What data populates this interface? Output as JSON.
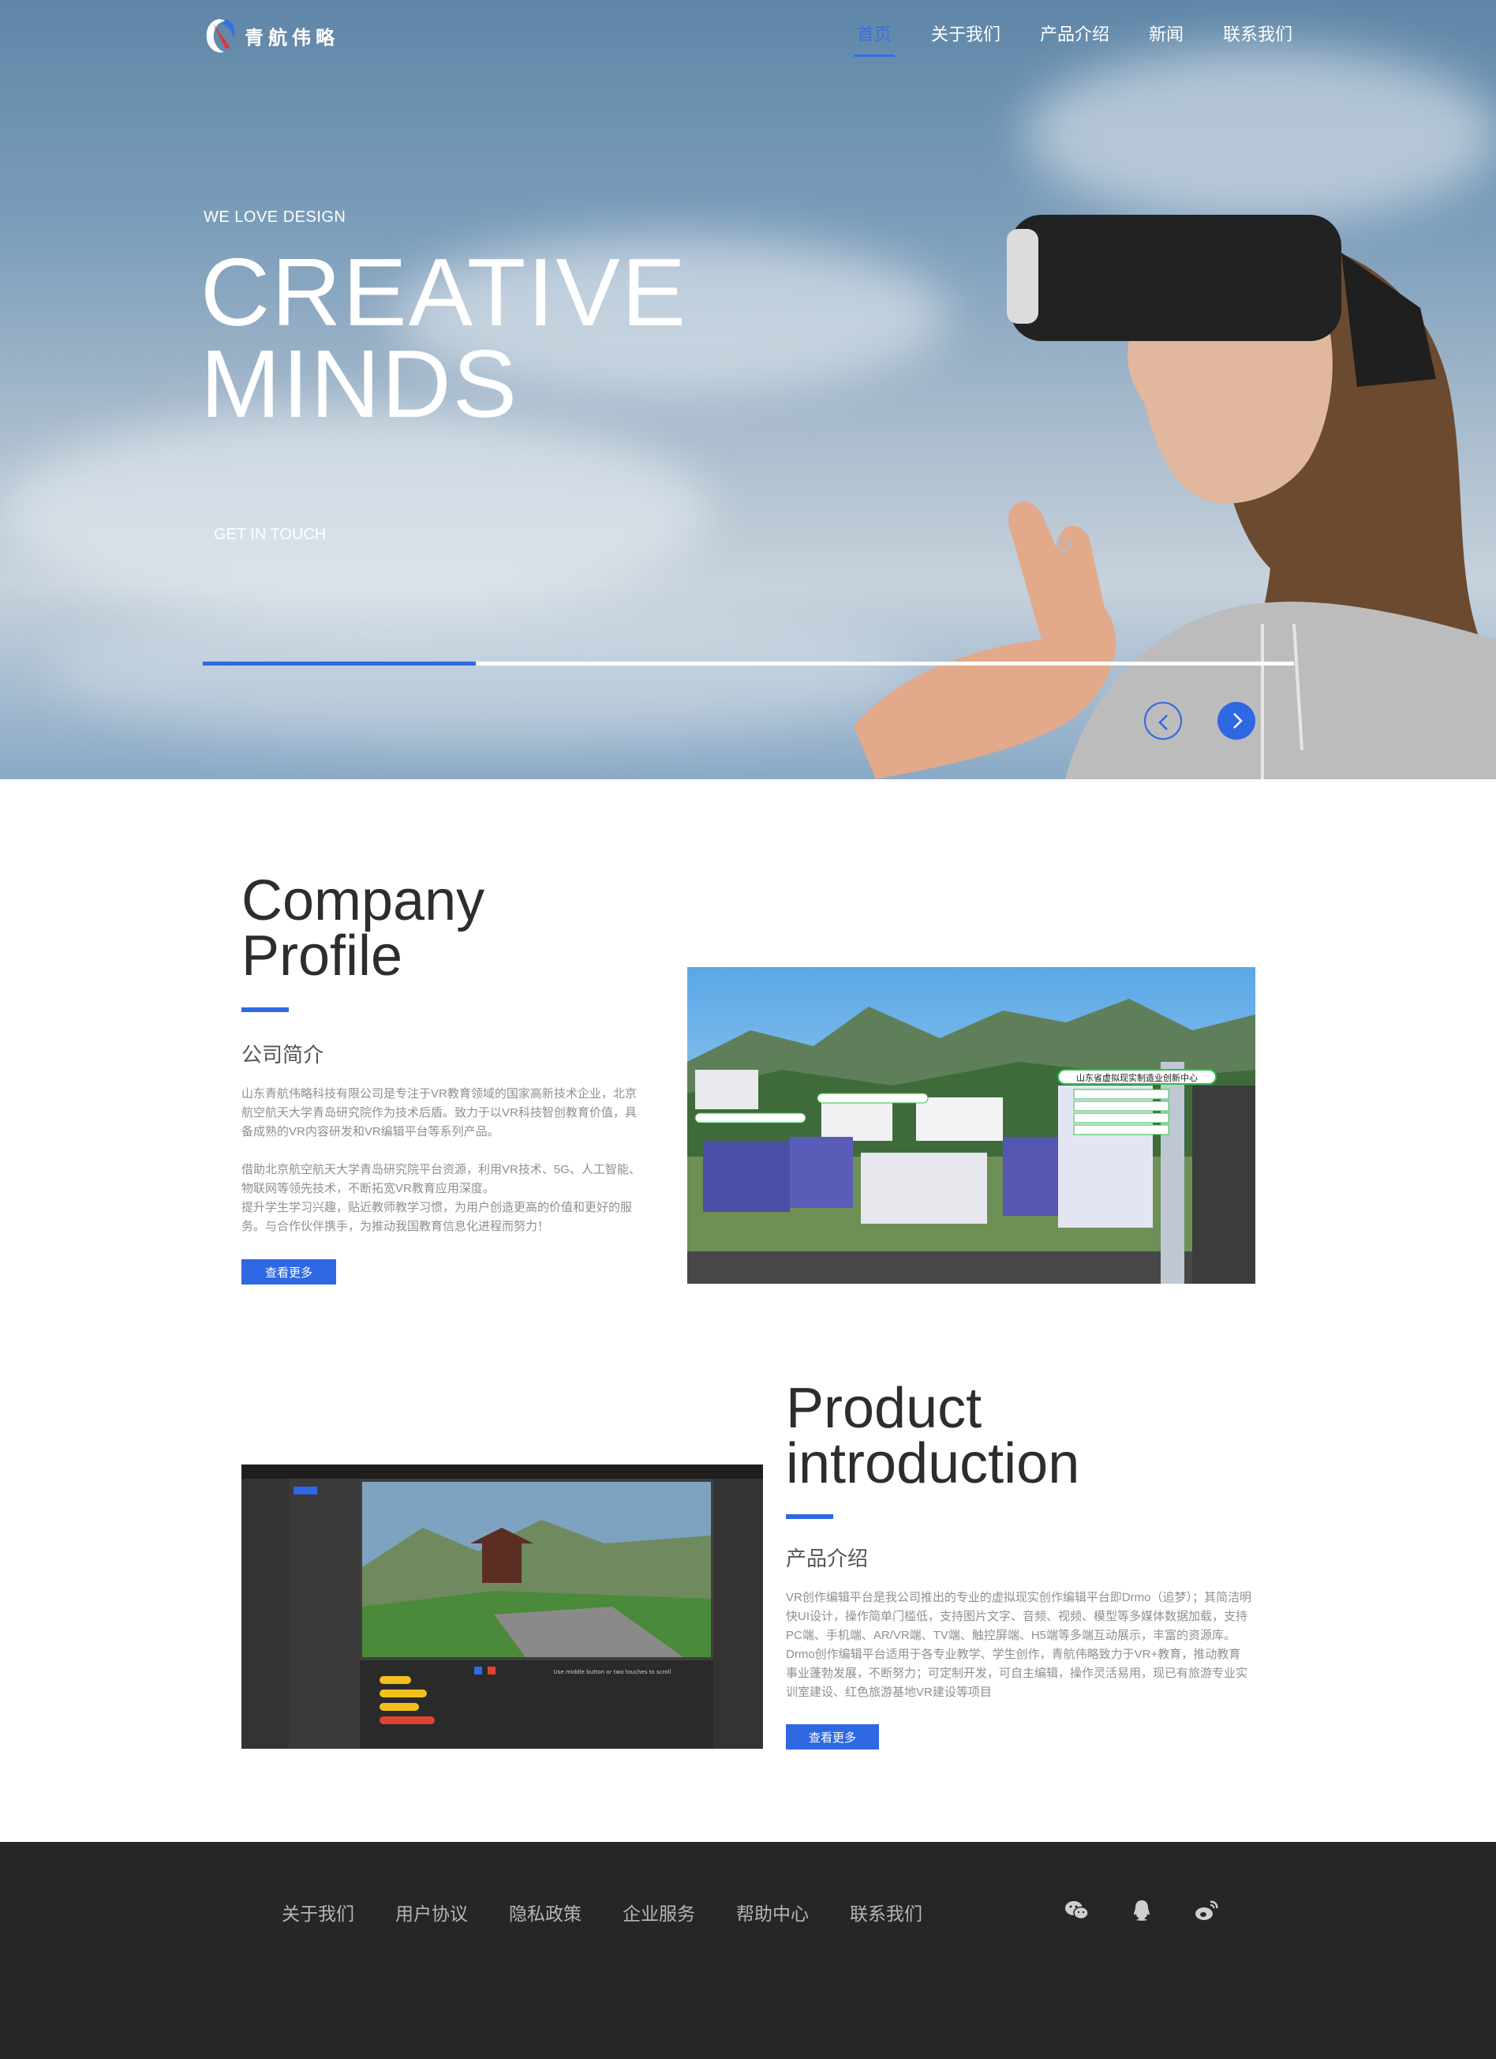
{
  "brand": {
    "name": "青航伟略",
    "accent": "#2f68e3"
  },
  "nav": {
    "items": [
      {
        "label": "首页",
        "active": true
      },
      {
        "label": "关于我们"
      },
      {
        "label": "产品介绍"
      },
      {
        "label": "新闻"
      },
      {
        "label": "联系我们"
      }
    ]
  },
  "hero": {
    "eyebrow": "WE LOVE DESIGN",
    "title_line1": "CREATIVE",
    "title_line2": "MINDS",
    "cta": "GET IN TOUCH",
    "slide_progress": 0.25,
    "prev_icon": "chevron-left-icon",
    "next_icon": "chevron-right-icon"
  },
  "profile": {
    "title_line1": "Company",
    "title_line2": "Profile",
    "subtitle": "公司简介",
    "paragraphs": [
      "山东青航伟略科技有限公司是专注于VR教育领域的国家高新技术企业，北京航空航天大学青岛研究院作为技术后盾。致力于以VR科技智创教育价值，具备成熟的VR内容研发和VR编辑平台等系列产品。",
      "借助北京航空航天大学青岛研究院平台资源，利用VR技术、5G、人工智能、物联网等领先技术，不断拓宽VR教育应用深度。",
      "提升学生学习兴趣，贴近教师教学习惯，为用户创造更高的价值和更好的服务。与合作伙伴携手，为推动我国教育信息化进程而努力！"
    ],
    "button": "查看更多",
    "image_banner": "山东省虚拟现实制造业创新中心"
  },
  "product": {
    "title_line1": "Product",
    "title_line2": "introduction",
    "subtitle": "产品介绍",
    "paragraph": "VR创作编辑平台是我公司推出的专业的虚拟现实创作编辑平台即Drmo（追梦）；其简洁明快UI设计，操作简单门槛低，支持图片文字、音频、视频、模型等多媒体数据加载，支持PC端、手机端、AR/VR端、TV端、触控屏端、H5端等多端互动展示，丰富的资源库。Drmo创作编辑平台适用于各专业教学、学生创作，青航伟略致力于VR+教育，推动教育事业蓬勃发展，不断努力；可定制开发，可自主编辑，操作灵活易用，现已有旅游专业实训室建设、红色旅游基地VR建设等项目",
    "button": "查看更多",
    "editor_hint": "Use middle button or two touches to scroll"
  },
  "footer": {
    "links": [
      "关于我们",
      "用户协议",
      "隐私政策",
      "企业服务",
      "帮助中心",
      "联系我们"
    ],
    "icons": [
      "wechat-icon",
      "qq-icon",
      "weibo-icon"
    ]
  }
}
